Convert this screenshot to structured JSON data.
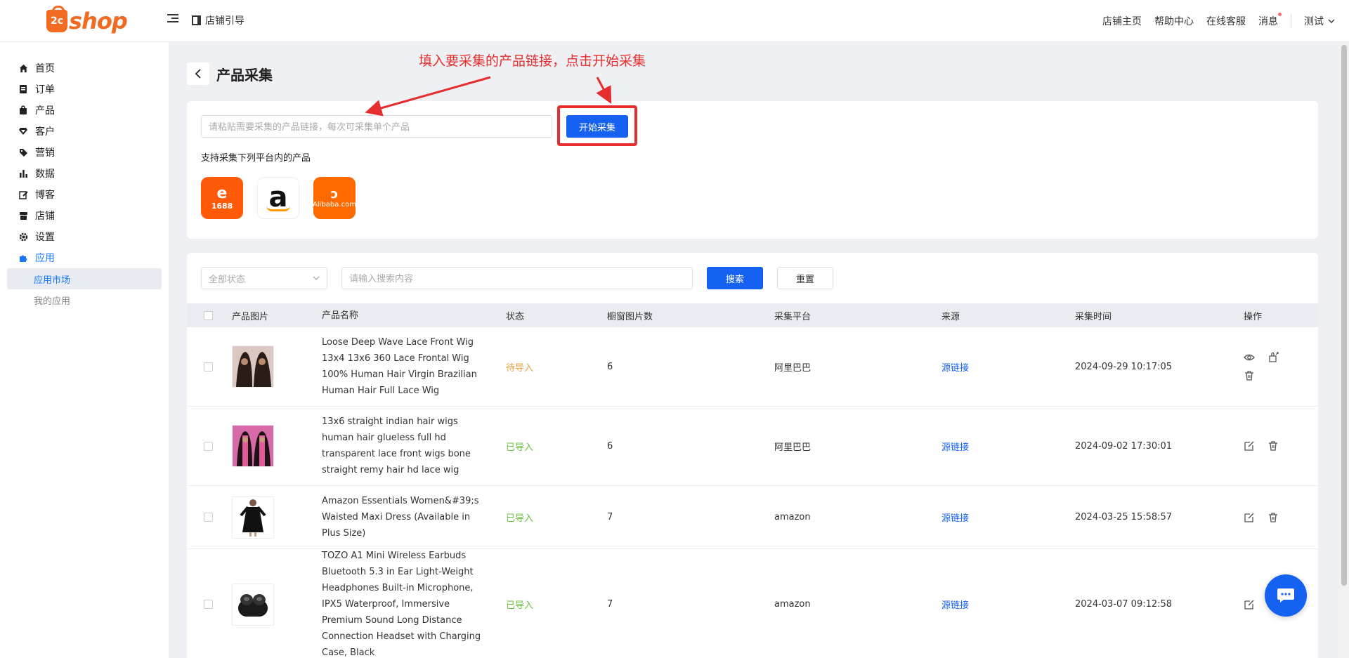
{
  "header": {
    "logo_text": "shop",
    "logo_mark": "2c",
    "guide_label": "店铺引导",
    "links": [
      "店铺主页",
      "帮助中心",
      "在线客服",
      "消息"
    ],
    "user_name": "测试"
  },
  "sidebar": {
    "items": [
      {
        "label": "首页",
        "icon": "home-icon"
      },
      {
        "label": "订单",
        "icon": "order-icon"
      },
      {
        "label": "产品",
        "icon": "bag-icon"
      },
      {
        "label": "客户",
        "icon": "diamond-icon"
      },
      {
        "label": "营销",
        "icon": "tag-icon"
      },
      {
        "label": "数据",
        "icon": "bar-chart-icon"
      },
      {
        "label": "博客",
        "icon": "edit-icon"
      },
      {
        "label": "店铺",
        "icon": "store-icon"
      },
      {
        "label": "设置",
        "icon": "gear-icon"
      },
      {
        "label": "应用",
        "icon": "puzzle-icon"
      }
    ],
    "sub_items": [
      "应用市场",
      "我的应用"
    ]
  },
  "page": {
    "title": "产品采集"
  },
  "annotation": {
    "text": "填入要采集的产品链接，点击开始采集",
    "color": "#e62e2e"
  },
  "collect": {
    "placeholder": "请粘贴需要采集的产品链接，每次可采集单个产品",
    "start_label": "开始采集",
    "support_text": "支持采集下列平台内的产品",
    "platforms": [
      "1688",
      "a",
      "Alibaba.com"
    ]
  },
  "filter": {
    "status_placeholder": "全部状态",
    "search_placeholder": "请输入搜索内容",
    "search_label": "搜索",
    "reset_label": "重置"
  },
  "table": {
    "columns": [
      "产品图片",
      "产品名称",
      "状态",
      "橱窗图片数",
      "采集平台",
      "来源",
      "采集时间",
      "操作"
    ],
    "rows": [
      {
        "name": "Loose Deep Wave Lace Front Wig 13x4 13x6 360 Lace Frontal Wig 100% Human Hair Virgin Brazilian Human Hair Full Lace Wig",
        "status": "待导入",
        "status_type": "pending",
        "count": "6",
        "platform": "阿里巴巴",
        "source": "源链接",
        "time": "2024-09-29 10:17:05"
      },
      {
        "name": "13x6 straight indian hair wigs human hair glueless full hd transparent lace front wigs bone straight remy hair hd lace wig",
        "status": "已导入",
        "status_type": "done",
        "count": "6",
        "platform": "阿里巴巴",
        "source": "源链接",
        "time": "2024-09-02 17:30:01"
      },
      {
        "name": "Amazon Essentials Women&#39;s Waisted Maxi Dress (Available in Plus Size)",
        "status": "已导入",
        "status_type": "done",
        "count": "7",
        "platform": "amazon",
        "source": "源链接",
        "time": "2024-03-25 15:58:57"
      },
      {
        "name": "TOZO A1 Mini Wireless Earbuds Bluetooth 5.3 in Ear Light-Weight Headphones Built-in Microphone, IPX5 Waterproof, Immersive Premium Sound Long Distance Connection Headset with Charging Case, Black",
        "status": "已导入",
        "status_type": "done",
        "count": "7",
        "platform": "amazon",
        "source": "源链接",
        "time": "2024-03-07 09:12:58"
      }
    ]
  },
  "colors": {
    "primary": "#1461f2",
    "brand": "#f26b21",
    "pending": "#e6a23c",
    "done": "#67c23a"
  }
}
